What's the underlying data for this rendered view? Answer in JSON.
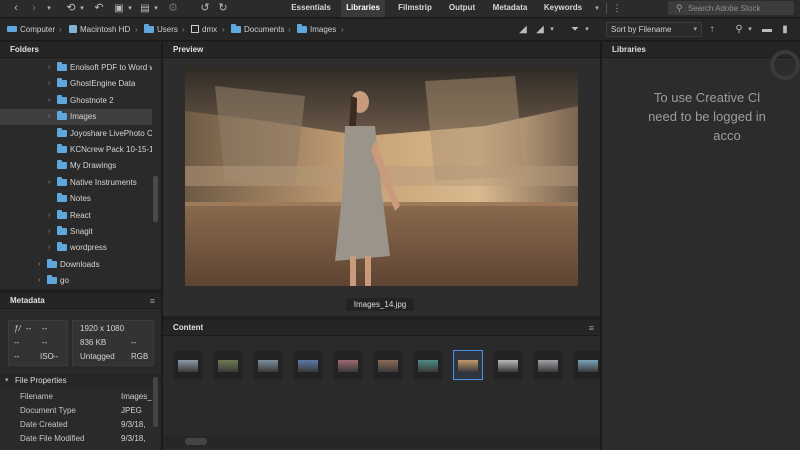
{
  "workspace_tabs": [
    {
      "label": "Essentials",
      "active": false
    },
    {
      "label": "Libraries",
      "active": true
    },
    {
      "label": "Filmstrip",
      "active": false
    },
    {
      "label": "Output",
      "active": false
    },
    {
      "label": "Metadata",
      "active": false
    },
    {
      "label": "Keywords",
      "active": false
    }
  ],
  "stock_search": {
    "placeholder": "Search Adobe Stock",
    "icon": "search-icon"
  },
  "path": {
    "items": [
      {
        "label": "Computer",
        "icon": "computer-icon"
      },
      {
        "label": "Macintosh HD",
        "icon": "drive-icon"
      },
      {
        "label": "Users",
        "icon": "folder-icon"
      },
      {
        "label": "dmx",
        "icon": "home-folder-icon"
      },
      {
        "label": "Documents",
        "icon": "folder-icon"
      },
      {
        "label": "Images",
        "icon": "folder-icon"
      }
    ],
    "separator": "›"
  },
  "sort": {
    "selected": "Sort by Filename"
  },
  "panels": {
    "folders": "Folders",
    "preview": "Preview",
    "libraries": "Libraries",
    "metadata": "Metadata",
    "content": "Content"
  },
  "folders": [
    {
      "label": "Enolsoft PDF to Word w"
    },
    {
      "label": "GhostEngine Data"
    },
    {
      "label": "Ghostnote 2"
    },
    {
      "label": "Images",
      "selected": true
    },
    {
      "label": "Joyoshare LivePhoto Co"
    },
    {
      "label": "KCNcrew Pack 10-15-18"
    },
    {
      "label": "My Drawings"
    },
    {
      "label": "Native Instruments"
    },
    {
      "label": "Notes"
    },
    {
      "label": "React"
    },
    {
      "label": "Snagit"
    },
    {
      "label": "wordpress"
    },
    {
      "label": "Downloads"
    },
    {
      "label": "go"
    }
  ],
  "metadata": {
    "exposure": [
      [
        "ƒ/",
        "--",
        "--"
      ],
      [
        "--",
        "--"
      ],
      [
        "--",
        "ISO",
        "--"
      ]
    ],
    "dimensions": "1920 x 1080",
    "size": "836 KB",
    "size_extra": "--",
    "color_profile": "Untagged",
    "color_mode": "RGB",
    "file_properties_label": "File Properties",
    "file_properties": [
      {
        "label": "Filename",
        "value": "Images_"
      },
      {
        "label": "Document Type",
        "value": "JPEG"
      },
      {
        "label": "Date Created",
        "value": "9/3/18,"
      },
      {
        "label": "Date File Modified",
        "value": "9/3/18,"
      }
    ]
  },
  "preview": {
    "caption": "Images_14.jpg"
  },
  "content": {
    "thumbnail_count": 11,
    "selected_index": 7
  },
  "libraries": {
    "message_lines": [
      "To use Creative Cl",
      "need to be logged in",
      "acco"
    ]
  },
  "colors": {
    "accent": "#4d8fe2",
    "folder": "#5fa8dd"
  }
}
